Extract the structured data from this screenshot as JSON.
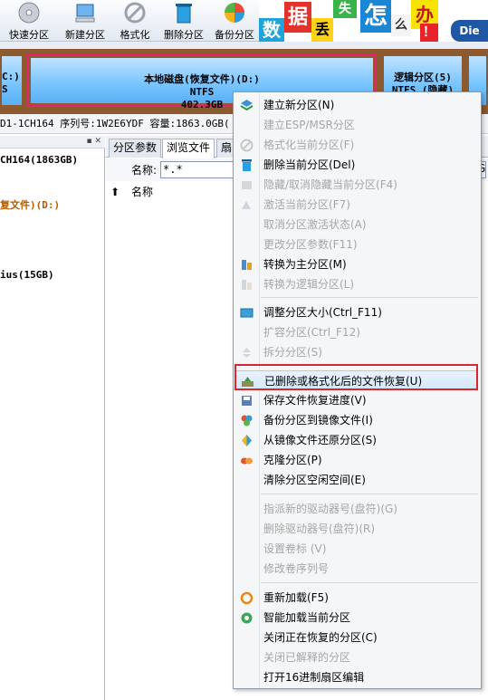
{
  "toolbar": {
    "buttons": [
      {
        "label": "快速分区",
        "icon": "cd-disk-icon"
      },
      {
        "label": "新建分区",
        "icon": "computer-icon"
      },
      {
        "label": "格式化",
        "icon": "format-icon"
      },
      {
        "label": "删除分区",
        "icon": "recycle-bin-icon"
      },
      {
        "label": "备份分区",
        "icon": "backup-icon"
      }
    ],
    "banner": {
      "chars": [
        "数",
        "据",
        "丢",
        "失",
        "怎",
        "么",
        "办",
        "！"
      ],
      "brand_partial": "Die"
    }
  },
  "disk": {
    "left_part": {
      "line1": "C:)",
      "line2": "S"
    },
    "selected_partition": {
      "name": "本地磁盘(恢复文件)(D:)",
      "fs": "NTFS",
      "size": "402.3GB"
    },
    "right_part": {
      "name": "逻辑分区(5)",
      "fs": "NTFS (隐藏)"
    },
    "info_line": "D1-1CH164  序列号:1W2E6YDF  容量:1863.0GB("
  },
  "tree": {
    "items": [
      "CH164(1863GB)",
      "复文件)(D:)",
      "ius(15GB)"
    ]
  },
  "tabs": [
    {
      "label": "分区参数"
    },
    {
      "label": "浏览文件"
    },
    {
      "label": "扇"
    }
  ],
  "right_edge_char": "G",
  "filter": {
    "label": "名称:",
    "value": "*.*"
  },
  "columns": {
    "name": "名称"
  },
  "colors": {
    "selected_border": "#e6246e",
    "highlight_box": "#d9272e",
    "disk_bar": "#8c5a2e"
  },
  "menu": {
    "items": [
      {
        "label": "建立新分区(N)",
        "enabled": true,
        "icon": "layers-icon"
      },
      {
        "label": "建立ESP/MSR分区",
        "enabled": false,
        "icon": ""
      },
      {
        "label": "格式化当前分区(F)",
        "enabled": false,
        "icon": "format-icon"
      },
      {
        "label": "删除当前分区(Del)",
        "enabled": true,
        "icon": "recycle-bin-icon"
      },
      {
        "label": "隐藏/取消隐藏当前分区(F4)",
        "enabled": false,
        "icon": "hide-icon"
      },
      {
        "label": "激活当前分区(F7)",
        "enabled": false,
        "icon": "activate-icon"
      },
      {
        "label": "取消分区激活状态(A)",
        "enabled": false,
        "icon": ""
      },
      {
        "label": "更改分区参数(F11)",
        "enabled": false,
        "icon": ""
      },
      {
        "label": "转换为主分区(M)",
        "enabled": true,
        "icon": "convert-primary-icon"
      },
      {
        "label": "转换为逻辑分区(L)",
        "enabled": false,
        "icon": "convert-logical-icon"
      },
      {
        "label": "调整分区大小(Ctrl_F11)",
        "enabled": true,
        "icon": "resize-icon"
      },
      {
        "label": "扩容分区(Ctrl_F12)",
        "enabled": false,
        "icon": ""
      },
      {
        "label": "拆分分区(S)",
        "enabled": false,
        "icon": "split-icon"
      },
      {
        "label": "已删除或格式化后的文件恢复(U)",
        "enabled": true,
        "icon": "file-recovery-icon"
      },
      {
        "label": "保存文件恢复进度(V)",
        "enabled": true,
        "icon": "save-icon"
      },
      {
        "label": "备份分区到镜像文件(I)",
        "enabled": true,
        "icon": "backup-image-icon"
      },
      {
        "label": "从镜像文件还原分区(S)",
        "enabled": true,
        "icon": "restore-image-icon"
      },
      {
        "label": "克隆分区(P)",
        "enabled": true,
        "icon": "clone-icon"
      },
      {
        "label": "清除分区空闲空间(E)",
        "enabled": true,
        "icon": ""
      },
      {
        "label": "指派新的驱动器号(盘符)(G)",
        "enabled": false,
        "icon": ""
      },
      {
        "label": "删除驱动器号(盘符)(R)",
        "enabled": false,
        "icon": ""
      },
      {
        "label": "设置卷标 (V)",
        "enabled": false,
        "icon": ""
      },
      {
        "label": "修改卷序列号",
        "enabled": false,
        "icon": ""
      },
      {
        "label": "重新加载(F5)",
        "enabled": true,
        "icon": "reload-icon"
      },
      {
        "label": "智能加载当前分区",
        "enabled": true,
        "icon": "smart-load-icon"
      },
      {
        "label": "关闭正在恢复的分区(C)",
        "enabled": true,
        "icon": ""
      },
      {
        "label": "关闭已解释的分区",
        "enabled": false,
        "icon": ""
      },
      {
        "label": "打开16进制扇区编辑",
        "enabled": true,
        "icon": ""
      }
    ]
  }
}
